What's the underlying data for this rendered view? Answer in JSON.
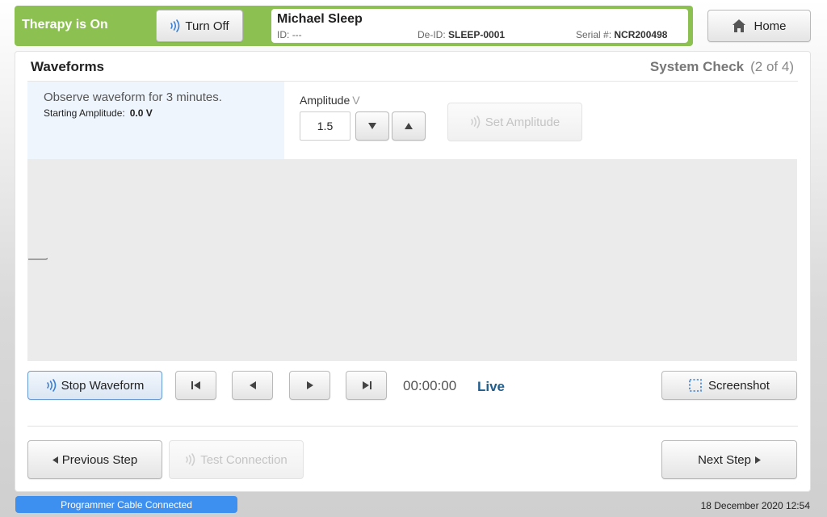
{
  "header": {
    "therapy_status": "Therapy is On",
    "turn_off_label": "Turn Off",
    "home_label": "Home",
    "patient": {
      "name": "Michael Sleep",
      "id_label": "ID:",
      "id_value": "---",
      "deid_label": "De-ID:",
      "deid_value": "SLEEP-0001",
      "serial_label": "Serial #:",
      "serial_value": "NCR200498"
    }
  },
  "panel": {
    "title": "Waveforms",
    "step_title": "System Check",
    "step_count": "(2 of 4)"
  },
  "instructions": {
    "text": "Observe waveform for 3 minutes.",
    "starting_amp_label": "Starting Amplitude:",
    "starting_amp_value": "0.0 V"
  },
  "amplitude": {
    "label": "Amplitude",
    "unit": "V",
    "value": "1.5",
    "set_label": "Set Amplitude"
  },
  "playback": {
    "stop_label": "Stop Waveform",
    "time": "00:00:00",
    "live_label": "Live",
    "screenshot_label": "Screenshot"
  },
  "nav": {
    "previous_label": "Previous Step",
    "test_connection_label": "Test Connection",
    "next_label": "Next Step"
  },
  "status_bar": {
    "cable_status": "Programmer Cable Connected",
    "datetime": "18 December 2020 12:54"
  },
  "icons": {
    "wave": "wave-icon",
    "home": "home-icon",
    "down": "triangle-down-icon",
    "up": "triangle-up-icon",
    "skip_start": "skip-start-icon",
    "play_back": "play-back-icon",
    "play_forward": "play-forward-icon",
    "skip_end": "skip-end-icon",
    "screenshot": "screenshot-icon"
  },
  "colors": {
    "therapy_green": "#8cc152",
    "accent_blue": "#3d8ff0",
    "live_blue": "#1f5e8e",
    "wave_blue": "#3a7fd5"
  }
}
